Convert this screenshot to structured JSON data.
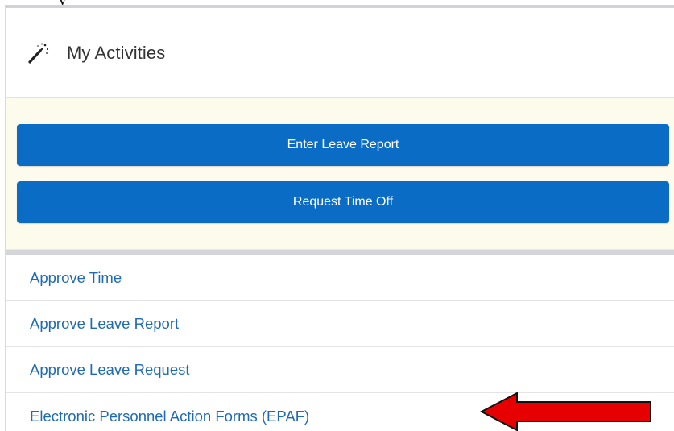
{
  "cutoff_text": "y",
  "header": {
    "title": "My Activities",
    "icon": "magic-wand-icon"
  },
  "actions": [
    {
      "label": "Enter Leave Report"
    },
    {
      "label": "Request Time Off"
    }
  ],
  "links": [
    {
      "label": "Approve Time"
    },
    {
      "label": "Approve Leave Report"
    },
    {
      "label": "Approve Leave Request"
    },
    {
      "label": "Electronic Personnel Action Forms (EPAF)"
    }
  ],
  "colors": {
    "button_bg": "#0b6cc5",
    "action_area_bg": "#fdfcec",
    "link_color": "#1f6bb1",
    "arrow_fill": "#e60000"
  },
  "annotation": {
    "icon": "red-arrow-icon",
    "points_to": "links.3"
  }
}
